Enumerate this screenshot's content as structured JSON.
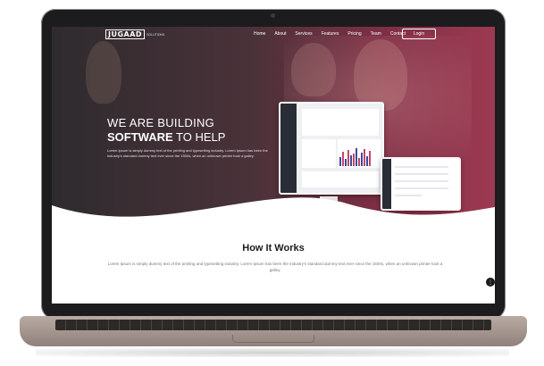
{
  "nav": {
    "logo": "JUGAAD",
    "logo_sub": "SOLUTIONS",
    "items": [
      "Home",
      "About",
      "Services",
      "Features",
      "Pricing",
      "Team",
      "Contact"
    ],
    "login": "Login"
  },
  "hero": {
    "line1": "WE ARE BUILDING",
    "line2_bold": "SOFTWARE",
    "line2_rest": " TO HELP",
    "body": "Lorem Ipsum is simply dummy text of the printing and typesetting industry. Lorem Ipsum has been the industry's standard dummy text ever since the 1500s, when an unknown printer took a galley."
  },
  "section": {
    "title": "How It Works",
    "body": "Lorem Ipsum is simply dummy text of the printing and typesetting industry. Lorem Ipsum has been the industry's standard dummy text ever since the 1500s, when an unknown printer took a galley."
  },
  "colors": {
    "hero_dark": "#2e2b2e",
    "hero_accent": "#9c3a52",
    "laptop_bezel": "#1c1c1e",
    "laptop_base": "#b9aaa2"
  },
  "icons": {
    "scroll_button": "scroll-icon"
  }
}
